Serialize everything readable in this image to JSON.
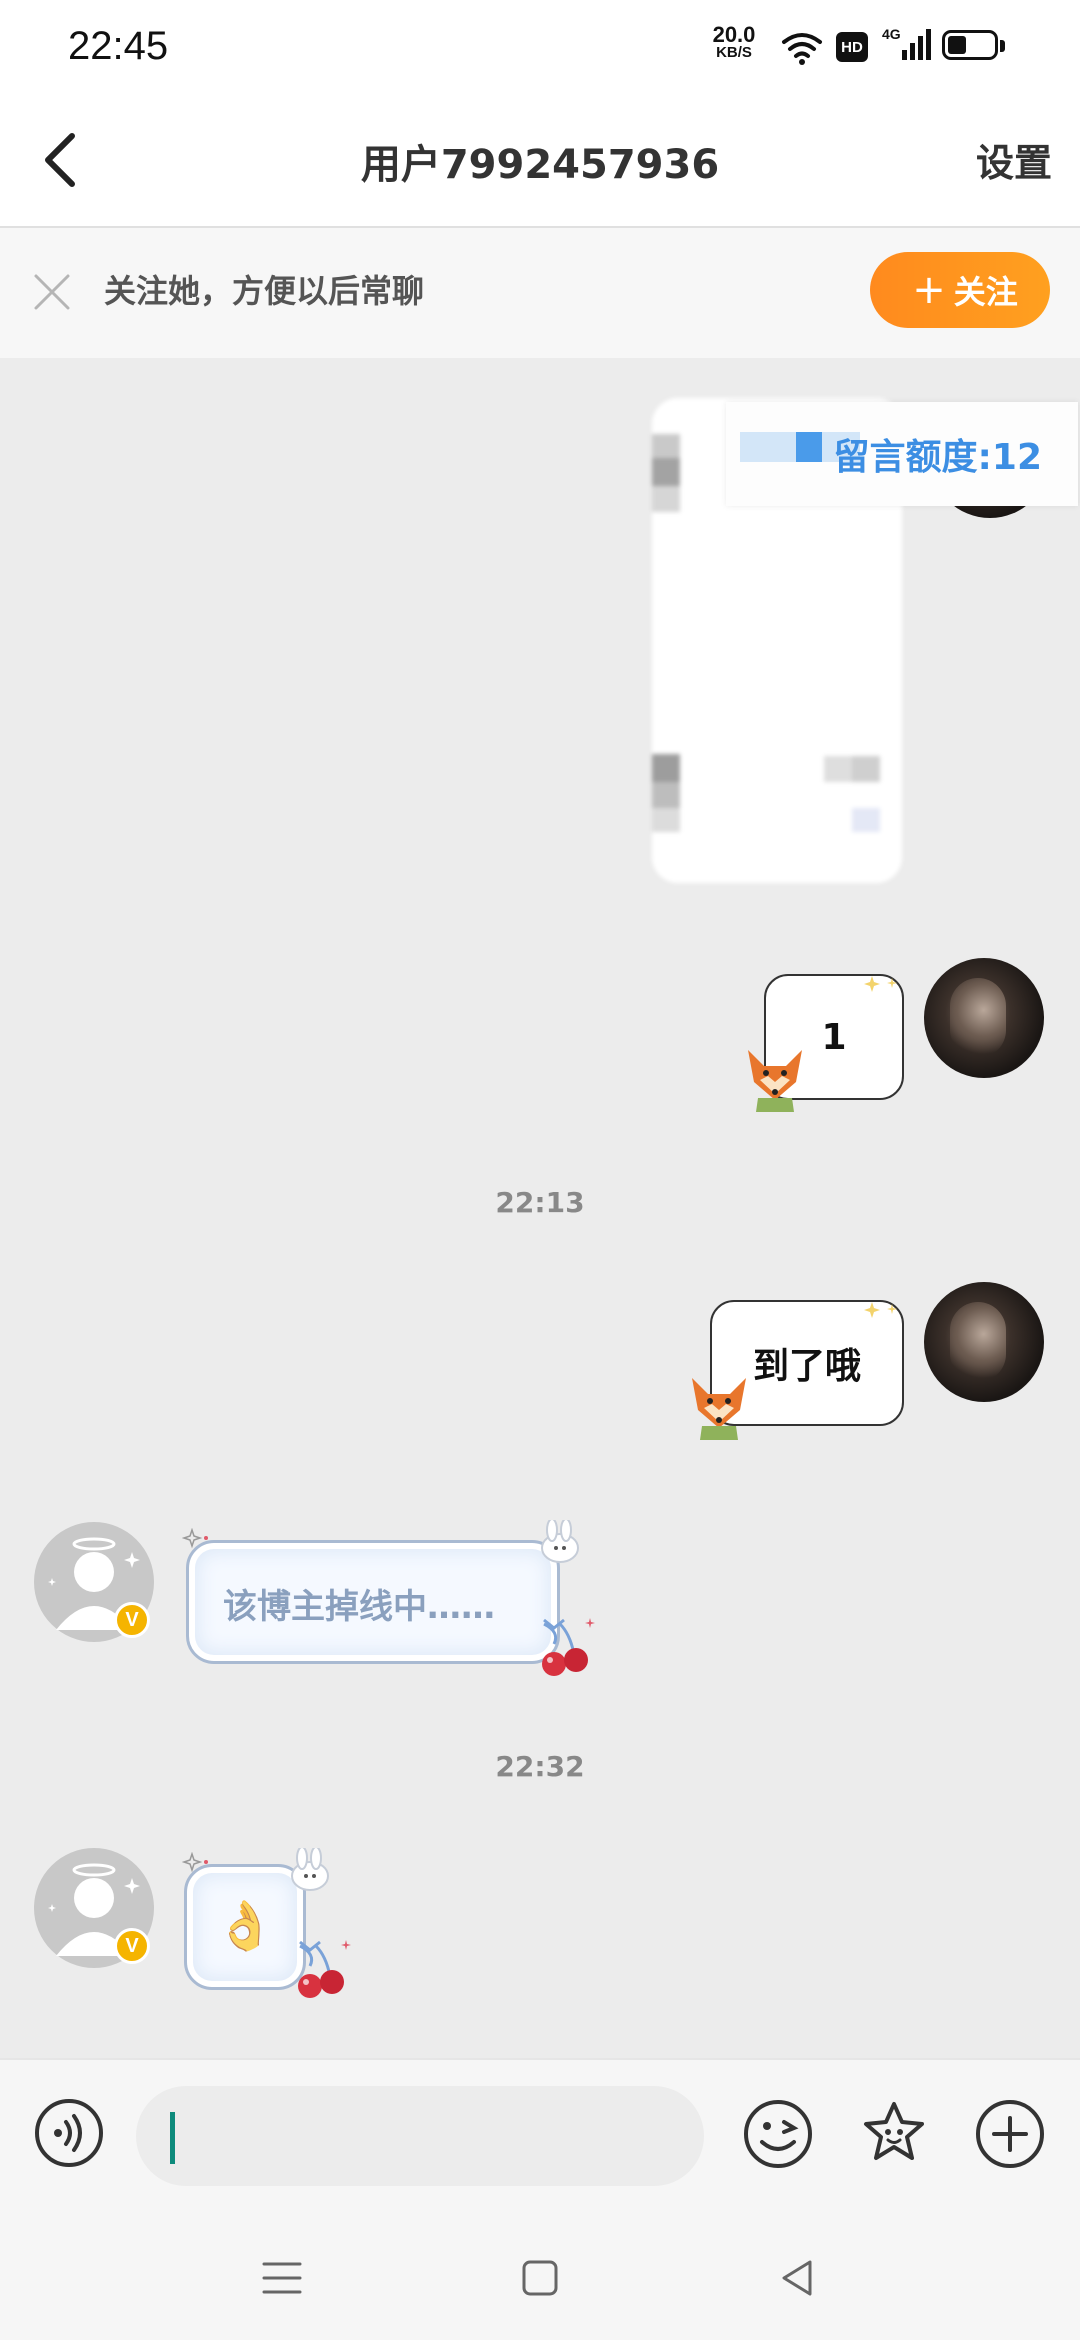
{
  "status_bar": {
    "time": "22:45",
    "net_speed_value": "20.0",
    "net_speed_unit": "KB/S",
    "hd_label": "HD",
    "network_label": "4G",
    "icons": [
      "wifi-icon",
      "hd-icon",
      "signal-icon",
      "battery-icon"
    ]
  },
  "header": {
    "title": "用户7992457936",
    "settings_label": "设置",
    "back_icon": "chevron-left-icon"
  },
  "follow_bar": {
    "text": "关注她，方便以后常聊",
    "button_label": "关注",
    "close_icon": "close-icon"
  },
  "chat": {
    "quota_label": "留言额度:12",
    "messages": [
      {
        "side": "right",
        "type": "blurred-image"
      },
      {
        "side": "right",
        "type": "text",
        "text": "1"
      },
      {
        "type": "timestamp",
        "text": "22:13"
      },
      {
        "side": "right",
        "type": "text",
        "text": "到了哦"
      },
      {
        "side": "left",
        "type": "text",
        "text": "该博主掉线中……"
      },
      {
        "type": "timestamp",
        "text": "22:32"
      },
      {
        "side": "left",
        "type": "emoji",
        "text": "👌"
      }
    ],
    "verified_badge": "V"
  },
  "input_bar": {
    "value": "",
    "icons": [
      "voice-icon",
      "emoji-icon",
      "sticker-icon",
      "plus-icon"
    ]
  },
  "nav_bar": {
    "icons": [
      "menu-icon",
      "home-icon",
      "back-icon"
    ]
  },
  "colors": {
    "accent": "#ff9018",
    "quota_blue": "#3c8ee3",
    "chat_background": "#ececec",
    "caret": "#0e8b7c"
  }
}
